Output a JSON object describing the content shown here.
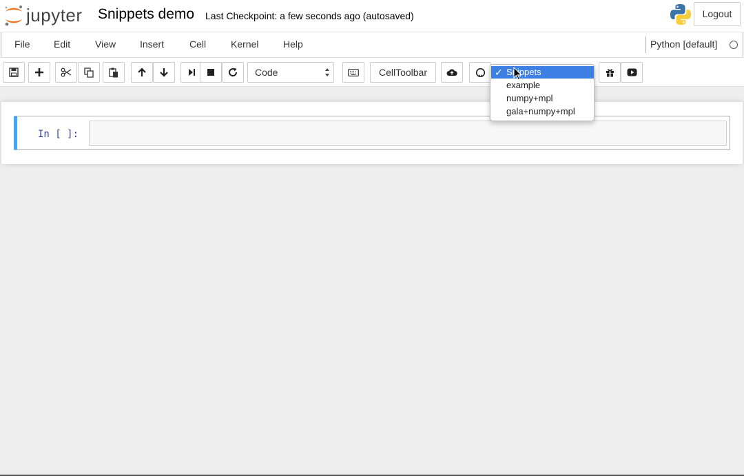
{
  "header": {
    "logo_text": "jupyter",
    "notebook_name": "Snippets demo",
    "checkpoint": "Last Checkpoint: a few seconds ago (autosaved)",
    "logout_label": "Logout"
  },
  "menubar": {
    "items": [
      "File",
      "Edit",
      "View",
      "Insert",
      "Cell",
      "Kernel",
      "Help"
    ],
    "kernel_name": "Python [default]"
  },
  "toolbar": {
    "icons": [
      "save-icon",
      "plus-icon",
      "cut-icon",
      "copy-icon",
      "paste-icon",
      "arrow-up-icon",
      "arrow-down-icon",
      "step-forward-icon",
      "stop-icon",
      "refresh-icon",
      "keyboard-icon",
      "cloud-upload-icon",
      "github-icon",
      "gift-icon",
      "play-circle-icon"
    ],
    "cell_type": "Code",
    "celltoolbar_label": "CellToolbar"
  },
  "snippets": {
    "selected": "Snippets",
    "check": "✓",
    "options": [
      "example",
      "numpy+mpl",
      "gala+numpy+mpl"
    ]
  },
  "cell": {
    "prompt": "In [ ]:",
    "source": ""
  },
  "colors": {
    "cell_selected_border": "#42a5f5",
    "prompt": "#303f9f",
    "dropdown_highlight": "#3d7fe3",
    "logo_orange": "#f37726"
  }
}
